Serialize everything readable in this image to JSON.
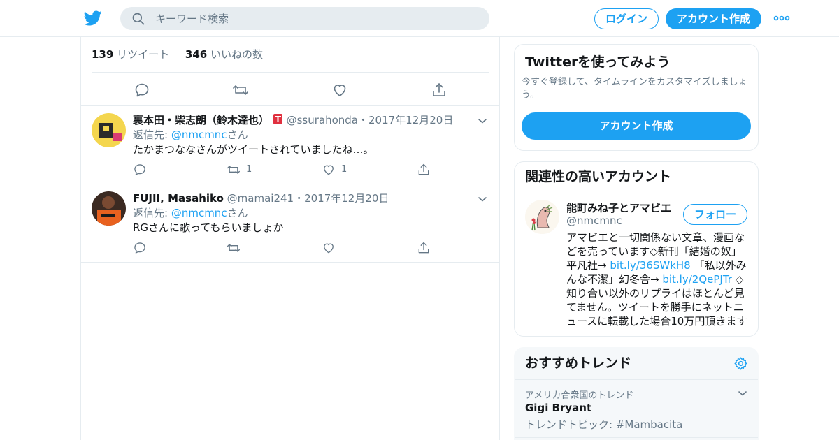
{
  "header": {
    "search_placeholder": "キーワード検索",
    "login_label": "ログイン",
    "signup_label": "アカウント作成"
  },
  "tweet": {
    "retweet_count": "139",
    "retweet_label": "リツイート",
    "like_count": "346",
    "like_label": "いいねの数"
  },
  "replies": [
    {
      "name": "裏本田・柴志朗（鈴木達也）",
      "handle": "@ssurahonda",
      "dot": "・",
      "date": "2017年12月20日",
      "reply_prefix": "返信先: ",
      "reply_to": "@nmcmnc",
      "reply_suffix": "さん",
      "text": "たかまつななさんがツイートされていましたね…。",
      "retweets": "1",
      "likes": "1"
    },
    {
      "name": "FUJII, Masahiko",
      "handle": "@mamai241",
      "dot": "・",
      "date": "2017年12月20日",
      "reply_prefix": "返信先: ",
      "reply_to": "@nmcmnc",
      "reply_suffix": "さん",
      "text": "RGさんに歌ってもらいましょか",
      "retweets": "",
      "likes": ""
    }
  ],
  "sidebar": {
    "signup_card": {
      "title": "Twitterを使ってみよう",
      "description": "今すぐ登録して、タイムラインをカスタマイズしましょう。",
      "button": "アカウント作成"
    },
    "related": {
      "title": "関連性の高いアカウント",
      "name": "能町みね子とアマビエ",
      "handle": "@nmcmnc",
      "follow_label": "フォロー",
      "bio_1": "アマビエと一切関係ない文章、漫画などを売っています◇新刊「結婚の奴」平凡社→ ",
      "bio_link_1": "bit.ly/36SWkH8",
      "bio_2": " 「私以外みんな不潔」幻冬舎→ ",
      "bio_link_2": "bit.ly/2QePJTr",
      "bio_3": " ◇知り合い以外のリプライはほとんど見てません。ツイートを勝手にネットニュースに転載した場合10万円頂きます"
    },
    "trends": {
      "title": "おすすめトレンド",
      "context": "アメリカ合衆国のトレンド",
      "name": "Gigi Bryant",
      "subtitle": "トレンドトピック: #Mambacita"
    }
  },
  "colors": {
    "accent": "#1da1f2",
    "secondary_text": "#657786",
    "border": "#e6ecf0"
  },
  "icons": [
    "twitter-logo-icon",
    "search-icon",
    "more-icon",
    "reply-icon",
    "retweet-icon",
    "like-icon",
    "share-icon",
    "chevron-down-icon",
    "gear-icon",
    "postbox-emoji-icon"
  ]
}
